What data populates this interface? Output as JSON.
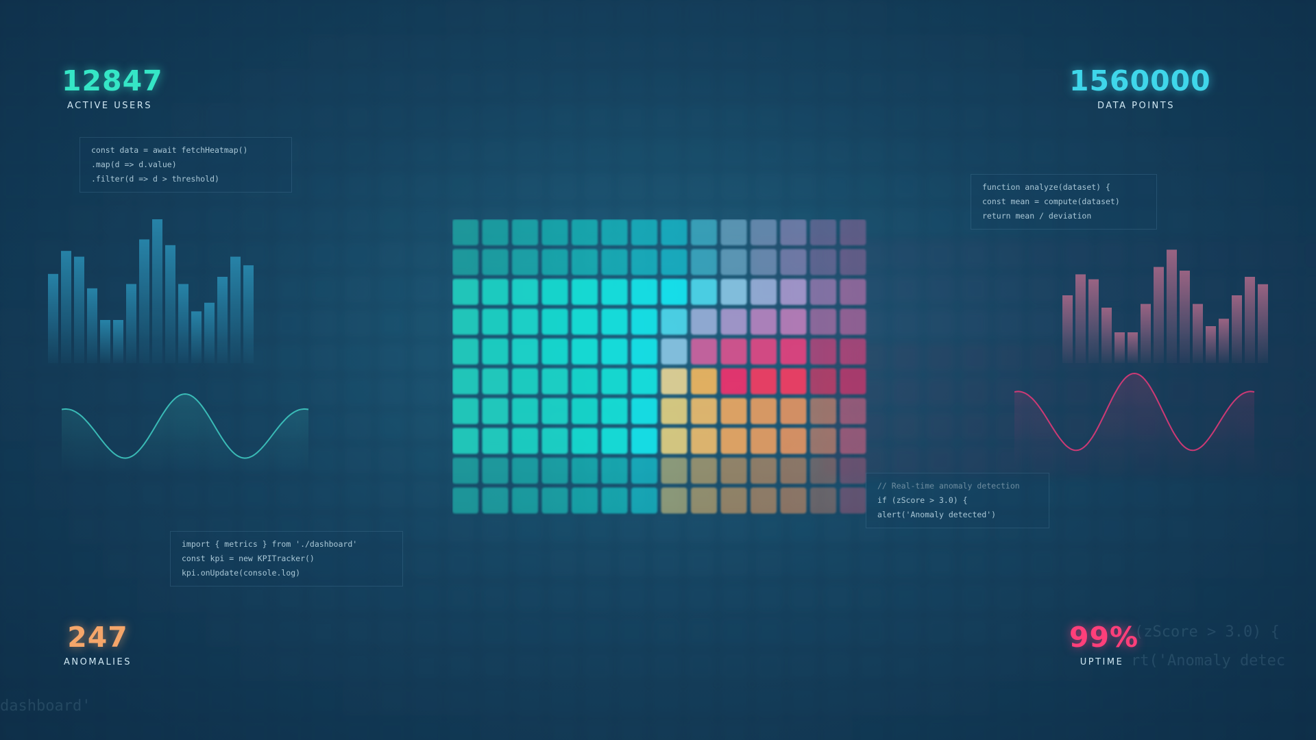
{
  "stats": {
    "active_users": {
      "value": "12847",
      "label": "ACTIVE USERS",
      "color": "#35e6c6"
    },
    "data_points": {
      "value": "1560000",
      "label": "DATA POINTS",
      "color": "#3fd6ea"
    },
    "anomalies": {
      "value": "247",
      "label": "ANOMALIES",
      "color": "#f5a66a"
    },
    "uptime": {
      "value": "99%",
      "label": "UPTIME",
      "color": "#ff3f7a"
    }
  },
  "code_snippets": {
    "top_left": [
      "const data = await fetchHeatmap()",
      ".map(d => d.value)",
      ".filter(d => d > threshold)"
    ],
    "top_right": [
      "function analyze(dataset) {",
      "const mean = compute(dataset)",
      "return mean / deviation"
    ],
    "bottom_left": [
      "import { metrics } from './dashboard'",
      "const kpi = new KPITracker()",
      "kpi.onUpdate(console.log)"
    ],
    "bottom_right": [
      "// Real-time anomaly detection",
      "if (zScore > 3.0) {",
      "alert('Anomaly detected')"
    ]
  },
  "ghost_text": {
    "bottom_left": "dashboard'",
    "right_1": "(zScore > 3.0) {",
    "right_2": "rt('Anomaly detec"
  },
  "colors": {
    "left_bars": "#2a8fb5",
    "right_bars": "#b06a8a",
    "left_wave": "#3ec8c0",
    "right_wave": "#e03a78"
  },
  "chart_data": [
    {
      "type": "heatmap",
      "rows": 10,
      "cols": 14,
      "values": [
        [
          0.1,
          0.15,
          0.2,
          0.25,
          0.3,
          0.35,
          0.4,
          0.45,
          0.5,
          0.55,
          0.6,
          0.65,
          0.7,
          0.75
        ],
        [
          0.1,
          0.15,
          0.2,
          0.25,
          0.3,
          0.35,
          0.4,
          0.45,
          0.5,
          0.55,
          0.6,
          0.65,
          0.7,
          0.75
        ],
        [
          0.1,
          0.15,
          0.2,
          0.25,
          0.3,
          0.35,
          0.4,
          0.45,
          0.5,
          0.55,
          0.6,
          0.65,
          0.7,
          0.75
        ],
        [
          0.1,
          0.15,
          0.2,
          0.25,
          0.3,
          0.35,
          0.4,
          0.5,
          0.6,
          0.65,
          0.7,
          0.72,
          0.75,
          0.78
        ],
        [
          0.1,
          0.15,
          0.2,
          0.25,
          0.3,
          0.35,
          0.4,
          0.55,
          0.8,
          0.85,
          0.88,
          0.9,
          0.9,
          0.9
        ],
        [
          0.1,
          0.12,
          0.15,
          0.18,
          0.22,
          0.28,
          0.35,
          0.6,
          0.65,
          0.95,
          1.0,
          1.0,
          0.98,
          0.95
        ],
        [
          0.1,
          0.12,
          0.15,
          0.18,
          0.22,
          0.3,
          0.4,
          0.55,
          0.58,
          0.62,
          0.66,
          0.7,
          0.75,
          0.9
        ],
        [
          0.1,
          0.12,
          0.15,
          0.18,
          0.25,
          0.32,
          0.42,
          0.52,
          0.56,
          0.6,
          0.64,
          0.68,
          0.72,
          0.76
        ],
        [
          0.1,
          0.12,
          0.15,
          0.18,
          0.25,
          0.32,
          0.42,
          0.5,
          0.54,
          0.58,
          0.62,
          0.66,
          0.7,
          0.74
        ],
        [
          0.1,
          0.12,
          0.15,
          0.18,
          0.25,
          0.32,
          0.4,
          0.48,
          0.52,
          0.56,
          0.6,
          0.64,
          0.68,
          0.72
        ]
      ]
    },
    {
      "type": "bar",
      "name": "left-bars",
      "values": [
        0.62,
        0.78,
        0.74,
        0.52,
        0.3,
        0.3,
        0.55,
        0.86,
        1.0,
        0.82,
        0.55,
        0.36,
        0.42,
        0.6,
        0.74,
        0.68
      ]
    },
    {
      "type": "bar",
      "name": "right-bars",
      "values": [
        0.55,
        0.72,
        0.68,
        0.45,
        0.25,
        0.25,
        0.48,
        0.78,
        0.92,
        0.75,
        0.48,
        0.3,
        0.36,
        0.55,
        0.7,
        0.64
      ]
    },
    {
      "type": "line",
      "name": "left-wave",
      "values": [
        0.5,
        0.1,
        0.95,
        0.1,
        0.5
      ]
    },
    {
      "type": "line",
      "name": "right-wave",
      "values": [
        0.5,
        0.1,
        0.95,
        0.1,
        0.5
      ]
    }
  ]
}
